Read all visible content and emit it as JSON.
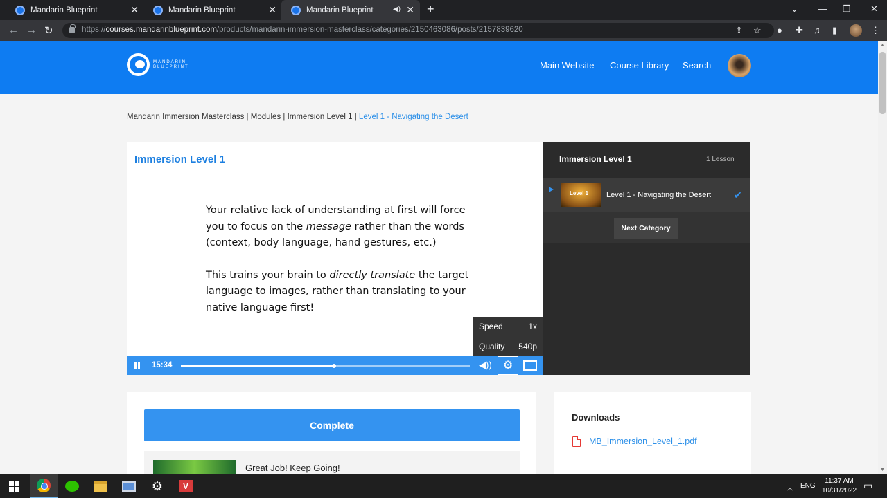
{
  "browser": {
    "tabs": [
      {
        "title": "Mandarin Blueprint"
      },
      {
        "title": "Mandarin Blueprint"
      },
      {
        "title": "Mandarin Blueprint"
      }
    ],
    "url_scheme": "https://",
    "url_host": "courses.mandarinblueprint.com",
    "url_path": "/products/mandarin-immersion-masterclass/categories/2150463086/posts/2157839620"
  },
  "header": {
    "logo_line1": "MANDARIN",
    "logo_line2": "BLUEPRINT",
    "nav": [
      "Main Website",
      "Course Library",
      "Search"
    ]
  },
  "breadcrumb": {
    "path": "Mandarin Immersion Masterclass | Modules | Immersion Level 1 | ",
    "current": "Level 1 - Navigating the Desert"
  },
  "lesson": {
    "title": "Immersion Level 1",
    "slide_p1_a": "Your relative lack of understanding at first will force you to focus on the ",
    "slide_p1_em": "message",
    "slide_p1_b": " rather than the words (context, body language, hand gestures, etc.)",
    "slide_p2_a": "This trains your brain to ",
    "slide_p2_em": "directly translate",
    "slide_p2_b": " the target language to images, rather than translating to your native language first!"
  },
  "player": {
    "time": "15:34",
    "progress": 0.53,
    "speed_label": "Speed",
    "speed_value": "1x",
    "quality_label": "Quality",
    "quality_value": "540p"
  },
  "sidebar": {
    "title": "Immersion Level 1",
    "count": "1 Lesson",
    "lesson_thumb_label": "Level 1",
    "lesson_title": "Level 1 - Navigating the Desert",
    "next_label": "Next Category"
  },
  "actions": {
    "complete_label": "Complete",
    "great_job": "Great Job! Keep Going!"
  },
  "downloads": {
    "title": "Downloads",
    "file": "MB_Immersion_Level_1.pdf"
  },
  "taskbar": {
    "lang": "ENG",
    "time": "11:37 AM",
    "date": "10/31/2022"
  }
}
